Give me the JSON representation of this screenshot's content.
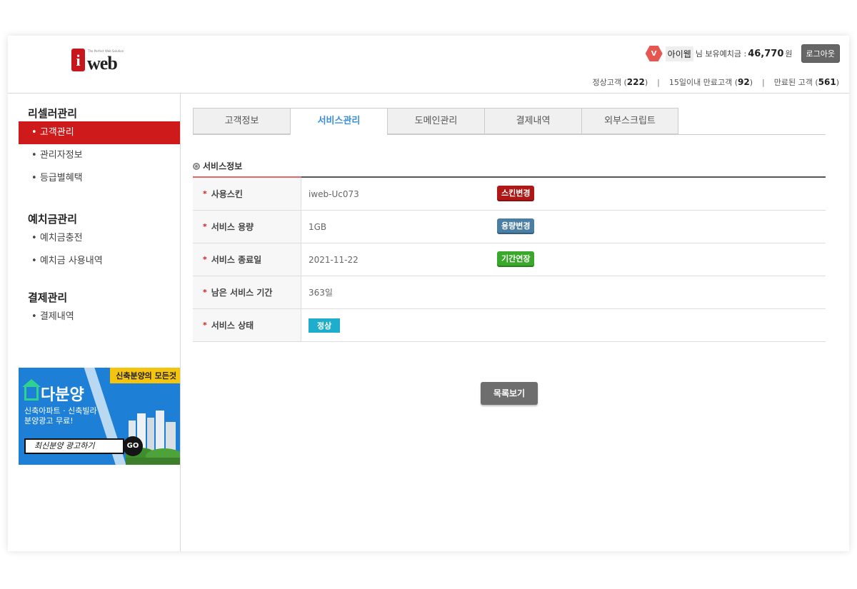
{
  "brand": {
    "logo_letter": "i",
    "logo_word": "web",
    "logo_tag": "The Perfect Web Solution"
  },
  "header": {
    "vip_badge": "V",
    "user_name": "아이웹",
    "user_suffix": "님 보유예치금 :",
    "balance": "46,770",
    "currency": "원",
    "logout_label": "로그아웃",
    "stats": [
      {
        "label": "정상고객",
        "count": "222"
      },
      {
        "label": "15일이내 만료고객",
        "count": "92"
      },
      {
        "label": "만료된 고객",
        "count": "561"
      }
    ],
    "separator": "|"
  },
  "sidebar": {
    "sections": [
      {
        "title": "리셀러관리",
        "items": [
          "고객관리",
          "관리자정보",
          "등급별혜택"
        ]
      },
      {
        "title": "예치금관리",
        "items": [
          "예치금충전",
          "예치금 사용내역"
        ]
      },
      {
        "title": "결제관리",
        "items": [
          "결제내역"
        ]
      }
    ],
    "bullet": "•"
  },
  "banner": {
    "tagline": "신축분양의 모든것",
    "name": "다분양",
    "subtitle_line1": "신축아파트 · 신축빌라",
    "subtitle_line2": "분양광고 무료!",
    "cta": "최신분양 광고하기",
    "go": "GO"
  },
  "tabs": [
    "고객정보",
    "서비스관리",
    "도메인관리",
    "결제내역",
    "외부스크립트"
  ],
  "active_tab": "서비스관리",
  "service_info": {
    "title": "서비스정보",
    "star": "*",
    "rows": [
      {
        "label": "사용스킨",
        "value": "iweb-Uc073",
        "button": "스킨변경"
      },
      {
        "label": "서비스 용량",
        "value": "1GB",
        "button": "용량변경"
      },
      {
        "label": "서비스 종료일",
        "value": "2021-11-22",
        "button": "기간연장"
      },
      {
        "label": "남은 서비스 기간",
        "value": "363일"
      },
      {
        "label": "서비스 상태",
        "status": "정상"
      }
    ]
  },
  "list_button": "목록보기",
  "colors": {
    "accent_red": "#ce1a1a",
    "tab_active": "#3a8fd8",
    "status_badge": "#1eaecb"
  }
}
